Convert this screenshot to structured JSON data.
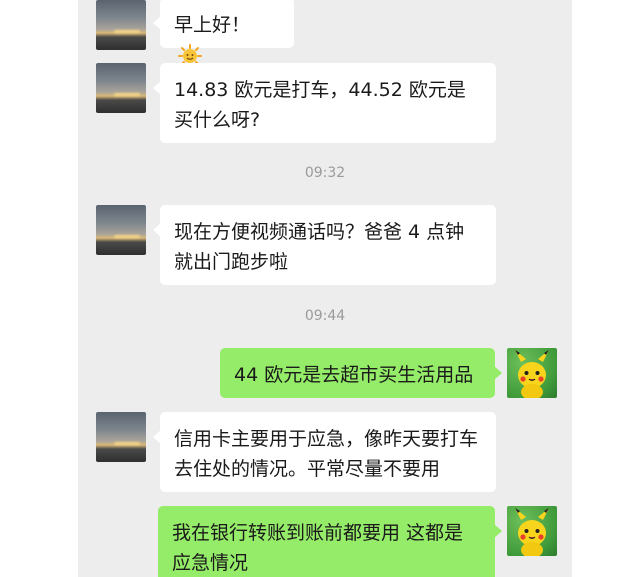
{
  "messages": [
    {
      "sender": "other",
      "text": "早上好！",
      "emoji": "sun-face"
    },
    {
      "sender": "other",
      "text": "14.83 欧元是打车，44.52 欧元是买什么呀?"
    },
    {
      "type": "time",
      "text": "09:32"
    },
    {
      "sender": "other",
      "text": "现在方便视频通话吗？爸爸 4 点钟就出门跑步啦"
    },
    {
      "type": "time",
      "text": "09:44"
    },
    {
      "sender": "me",
      "text": "44 欧元是去超市买生活用品"
    },
    {
      "sender": "other",
      "text": "信用卡主要用于应急，像昨天要打车去住处的情况。平常尽量不要用"
    },
    {
      "sender": "me",
      "text": "我在银行转账到账前都要用 这都是应急情况"
    }
  ],
  "colors": {
    "chat_bg": "#ededed",
    "incoming_bubble": "#ffffff",
    "outgoing_bubble": "#95ec69",
    "timestamp": "#9a9a9a"
  },
  "icons": {
    "other_avatar": "sunset-sky-avatar",
    "my_avatar": "pikachu-avatar"
  }
}
